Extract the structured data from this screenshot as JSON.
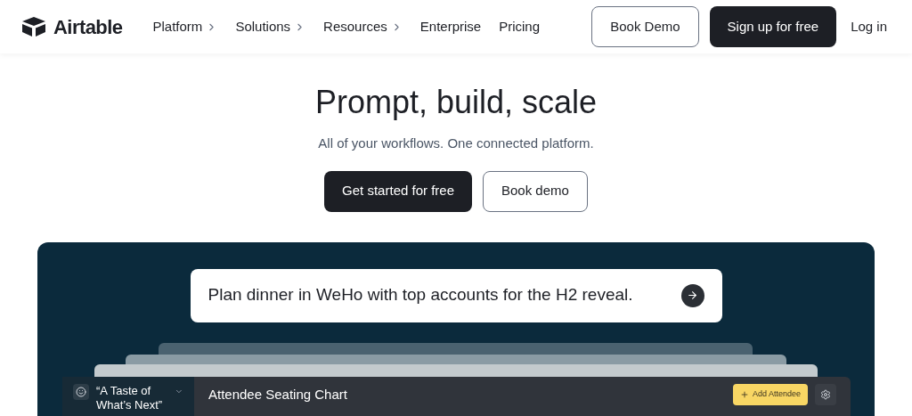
{
  "nav": {
    "brand": "Airtable",
    "items": [
      {
        "label": "Platform",
        "has_menu": true
      },
      {
        "label": "Solutions",
        "has_menu": true
      },
      {
        "label": "Resources",
        "has_menu": true
      },
      {
        "label": "Enterprise",
        "has_menu": false
      },
      {
        "label": "Pricing",
        "has_menu": false
      }
    ],
    "book_demo": "Book Demo",
    "sign_up": "Sign up for free",
    "log_in": "Log in"
  },
  "hero": {
    "title": "Prompt, build, scale",
    "subtitle": "All of your workflows. One connected platform.",
    "primary": "Get started for free",
    "secondary": "Book demo"
  },
  "demo": {
    "prompt": "Plan dinner in WeHo with top accounts for the H2 reveal.",
    "app": {
      "base_name": "“A Taste of What’s Next”",
      "table_title": "Attendee Seating Chart",
      "add_button": "Add Attendee"
    }
  }
}
